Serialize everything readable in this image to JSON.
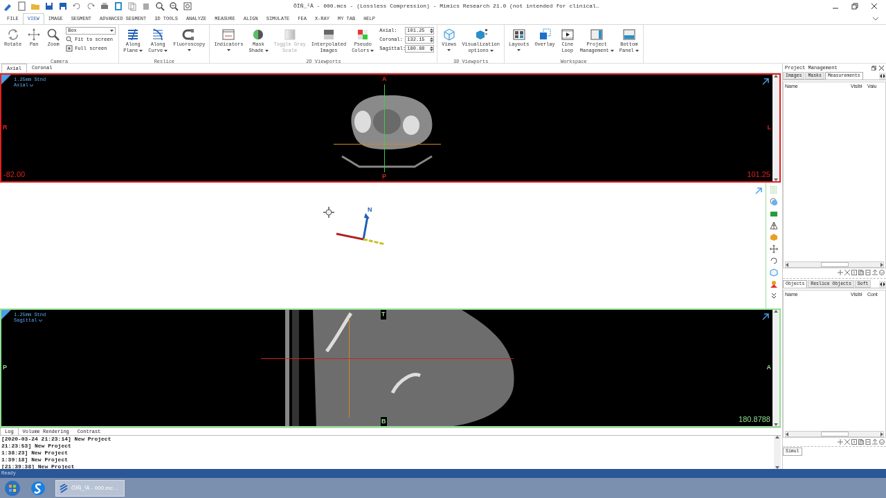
{
  "window": {
    "title": "ÕÎÑ_²Â - 000.mcs -  (Lossless Compression) - Mimics Research 21.0 (not intended for clinical…"
  },
  "menu": [
    {
      "label": "FILE",
      "selected": false
    },
    {
      "label": "VIEW",
      "selected": true
    },
    {
      "label": "IMAGE",
      "selected": false
    },
    {
      "label": "SEGMENT",
      "selected": false
    },
    {
      "label": "ADVANCED SEGMENT",
      "selected": false
    },
    {
      "label": "3D TOOLS",
      "selected": false
    },
    {
      "label": "ANALYZE",
      "selected": false
    },
    {
      "label": "MEASURE",
      "selected": false
    },
    {
      "label": "ALIGN",
      "selected": false
    },
    {
      "label": "SIMULATE",
      "selected": false
    },
    {
      "label": "FEA",
      "selected": false
    },
    {
      "label": "X-RAY",
      "selected": false
    },
    {
      "label": "MY TAB",
      "selected": false
    },
    {
      "label": "HELP",
      "selected": false
    }
  ],
  "ribbon": [
    {
      "label": "Camera",
      "buttons": [
        {
          "lines": [
            "Rotate"
          ],
          "dropdown": false,
          "disabled": false
        },
        {
          "lines": [
            "Pan"
          ],
          "dropdown": false,
          "disabled": false
        },
        {
          "lines": [
            "Zoom"
          ],
          "dropdown": false,
          "disabled": false
        }
      ],
      "combo": "Box",
      "small_buttons": [
        "Fit to screen",
        "Full screen"
      ]
    },
    {
      "label": "Reslice",
      "buttons": [
        {
          "lines": [
            "Along",
            "Plane"
          ],
          "dropdown": true,
          "disabled": false
        },
        {
          "lines": [
            "Along",
            "Curve"
          ],
          "dropdown": true,
          "disabled": false
        },
        {
          "lines": [
            "Fluoroscopy"
          ],
          "dropdown": true,
          "disabled": false
        }
      ]
    },
    {
      "label": "2D Viewports",
      "buttons": [
        {
          "lines": [
            "Indicators"
          ],
          "dropdown": true,
          "disabled": false
        },
        {
          "lines": [
            "Mask",
            "Shade"
          ],
          "dropdown": true,
          "disabled": false
        },
        {
          "lines": [
            "Toggle Gray",
            "Scale"
          ],
          "dropdown": false,
          "disabled": true
        },
        {
          "lines": [
            "Interpolated",
            "Images"
          ],
          "dropdown": false,
          "disabled": false
        },
        {
          "lines": [
            "Pseudo",
            "Colors"
          ],
          "dropdown": true,
          "disabled": false
        }
      ],
      "spins": [
        {
          "label": "Axial:",
          "value": "101.25"
        },
        {
          "label": "Coronal:",
          "value": "132.15"
        },
        {
          "label": "Sagittal:",
          "value": "180.88"
        }
      ]
    },
    {
      "label": "3D Viewports",
      "buttons": [
        {
          "lines": [
            "Views"
          ],
          "dropdown": true,
          "disabled": false
        },
        {
          "lines": [
            "Visualization",
            "options"
          ],
          "dropdown": true,
          "disabled": false
        }
      ]
    },
    {
      "label": "Workspace",
      "buttons": [
        {
          "lines": [
            "Layouts"
          ],
          "dropdown": true,
          "disabled": false
        },
        {
          "lines": [
            "Overlay"
          ],
          "dropdown": false,
          "disabled": false
        },
        {
          "lines": [
            "Cine",
            "Loop"
          ],
          "dropdown": false,
          "disabled": false
        },
        {
          "lines": [
            "Project",
            "Management"
          ],
          "dropdown": true,
          "disabled": false
        },
        {
          "lines": [
            "Bottom",
            "Panel"
          ],
          "dropdown": true,
          "disabled": false
        }
      ]
    }
  ],
  "view_tabs": [
    {
      "label": "Axial",
      "selected": true
    },
    {
      "label": "Coronal",
      "selected": false
    }
  ],
  "viewports": [
    {
      "kind": "slice",
      "color": "#e02020",
      "series": "1.25mm Stnd",
      "view": "Axial",
      "top": "A",
      "bottom": "P",
      "left": "R",
      "right": "L",
      "left_value": "-82.00",
      "right_value": "101.25"
    },
    {
      "kind": "volume",
      "axis_label": "N"
    },
    {
      "kind": "slice",
      "color": "#90e090",
      "series": "1.25mm Stnd",
      "view": "Sagittal",
      "top": "T",
      "bottom": "B",
      "left": "P",
      "right": "A",
      "right_value": "180.8788"
    }
  ],
  "bottom_panel": {
    "tabs": [
      {
        "label": "Log",
        "selected": true
      },
      {
        "label": "Volume Rendering",
        "selected": false
      },
      {
        "label": "Contrast",
        "selected": false
      }
    ],
    "log": [
      "[2020-03-24 21:23:14] New Project",
      "21:23:53] New Project",
      "1:38:23] New Project",
      "1:39:18] New Project",
      "[21:39:38] New Project"
    ]
  },
  "status_bar": "Ready",
  "project_management": {
    "title": "Project Management",
    "tabs": [
      {
        "label": "Images",
        "selected": false
      },
      {
        "label": "Masks",
        "selected": false
      },
      {
        "label": "Measurements",
        "selected": true
      }
    ],
    "columns": [
      "Name",
      "Visibl",
      "Valu"
    ]
  },
  "objects": {
    "tabs": [
      {
        "label": "Objects",
        "selected": true
      },
      {
        "label": "Reslice Objects",
        "selected": false
      },
      {
        "label": "Soft",
        "selected": false
      }
    ],
    "columns": [
      "Name",
      "Visibl",
      "Cont"
    ],
    "bottom_tab": "Simul"
  },
  "taskbar": {
    "task": "ÕÎÑ_²Â - 000.mc…"
  }
}
